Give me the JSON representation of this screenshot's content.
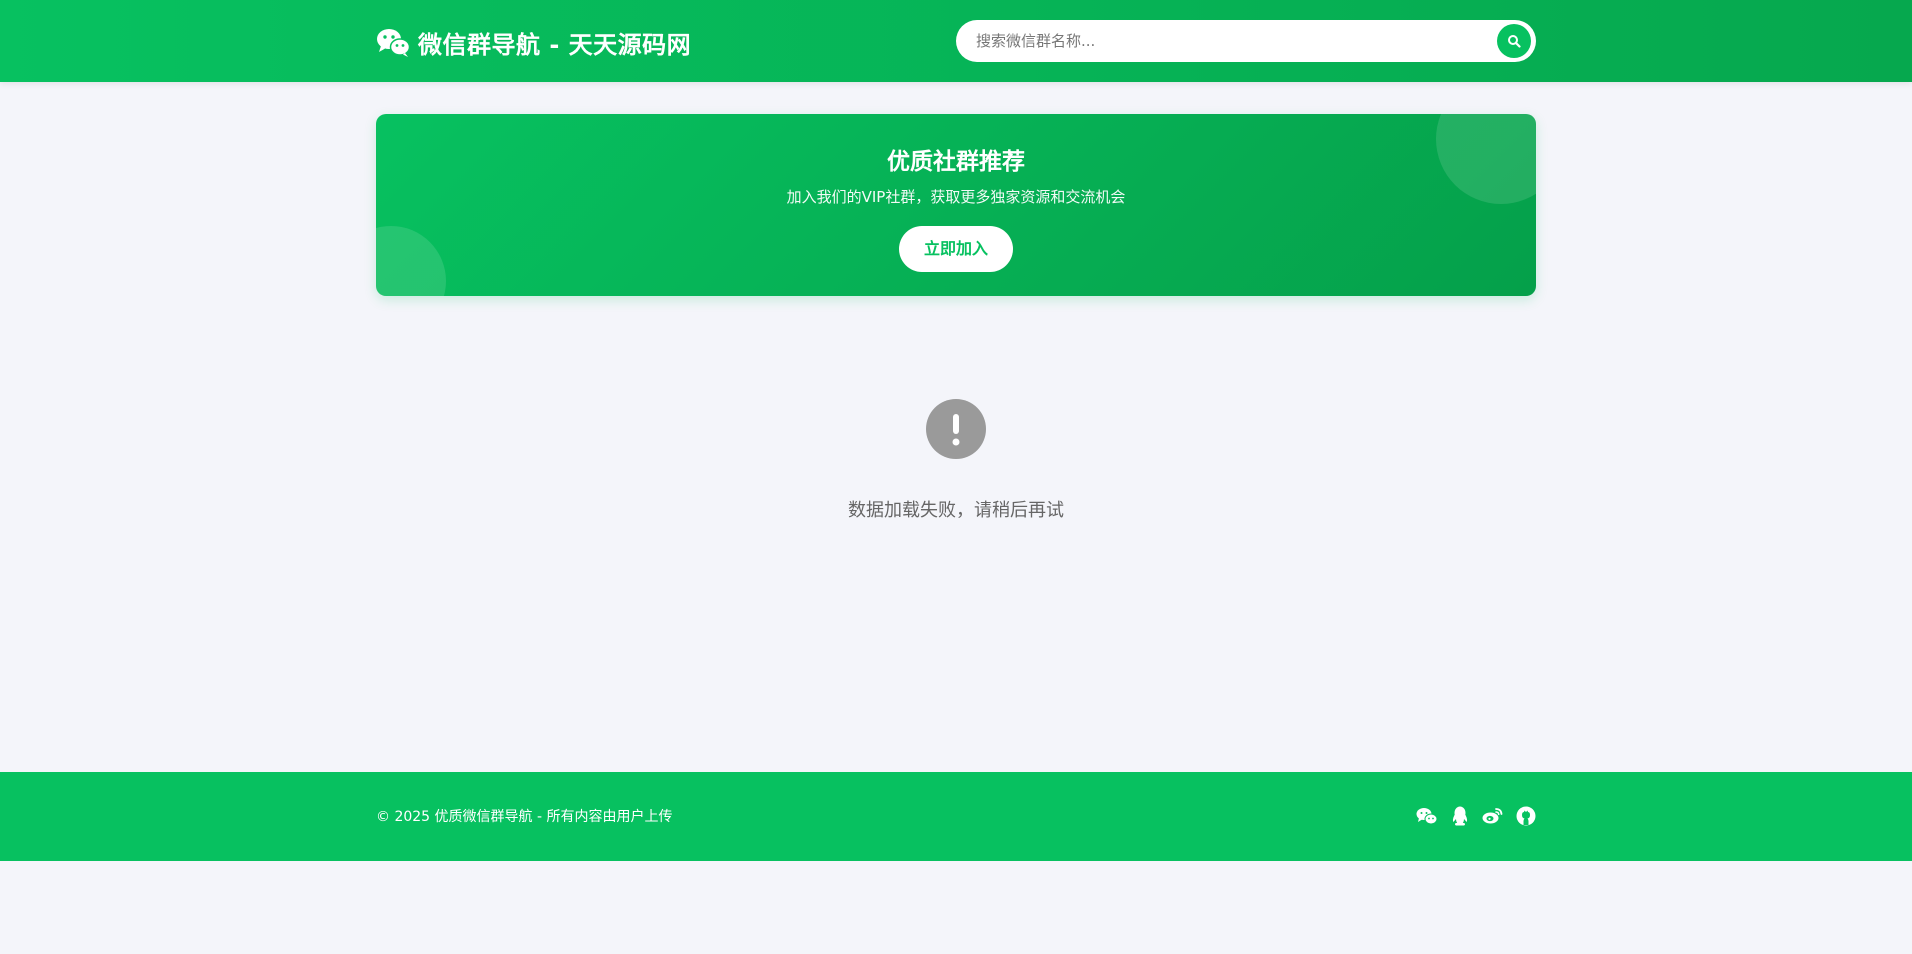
{
  "header": {
    "logo_icon": "wechat-icon",
    "title": "微信群导航 - 天天源码网",
    "search": {
      "placeholder": "搜索微信群名称...",
      "value": "",
      "button_icon": "search-icon"
    }
  },
  "banner": {
    "title": "优质社群推荐",
    "subtitle": "加入我们的VIP社群，获取更多独家资源和交流机会",
    "button_label": "立即加入"
  },
  "empty_state": {
    "icon": "exclamation-circle-icon",
    "message": "数据加载失败，请稍后再试"
  },
  "footer": {
    "copyright": "© 2025 优质微信群导航 - 所有内容由用户上传",
    "social_icons": [
      "wechat-icon",
      "qq-icon",
      "weibo-icon",
      "github-icon"
    ]
  },
  "colors": {
    "brand_green": "#07c160",
    "background": "#f4f5fa",
    "muted_icon": "#9a9a9a"
  }
}
